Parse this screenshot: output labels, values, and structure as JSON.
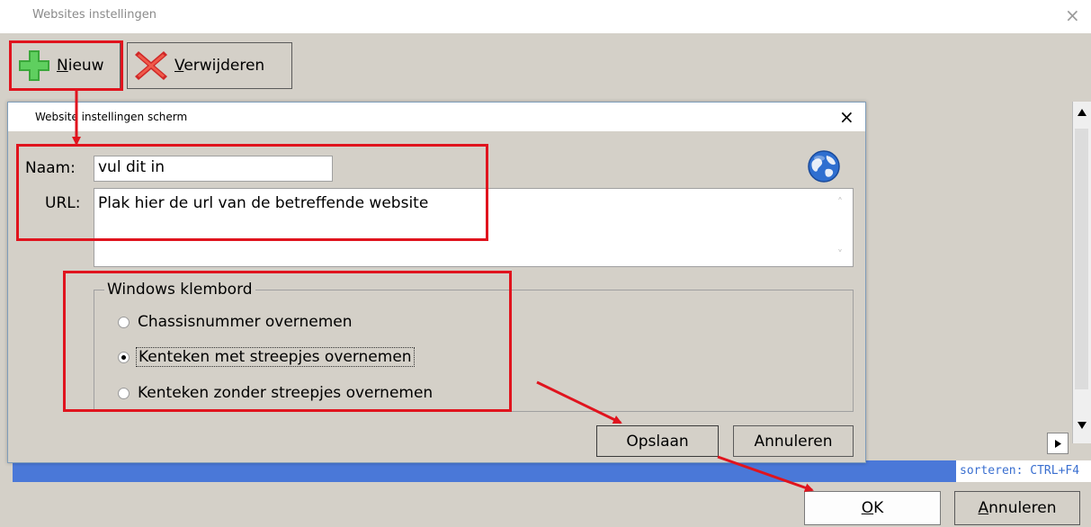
{
  "outer_window": {
    "title": "Websites instellingen",
    "close_glyph": "×"
  },
  "toolbar": {
    "new_label_ul": "N",
    "new_label_rest": "ieuw",
    "delete_label_ul": "V",
    "delete_label_rest": "erwijderen",
    "new_icon": "green-plus-icon",
    "delete_icon": "red-x-icon"
  },
  "dialog": {
    "title": "Website instellingen scherm",
    "close_glyph": "×",
    "name_label": "Naam:",
    "name_value": "vul dit in",
    "url_label": "URL:",
    "url_value": "Plak hier de url van de betreffende website",
    "globe_icon": "globe-icon",
    "group_title": "Windows klembord",
    "options": [
      {
        "label": "Chassisnummer overnemen",
        "selected": false
      },
      {
        "label": "Kenteken met streepjes overnemen",
        "selected": true
      },
      {
        "label": "Kenteken zonder streepjes overnemen",
        "selected": false
      }
    ],
    "save_label": "Opslaan",
    "cancel_label": "Annuleren"
  },
  "status": {
    "hint": "sorteren: CTRL+F4"
  },
  "footer": {
    "ok_label_ul": "O",
    "ok_label_rest": "K",
    "cancel_label_ul": "A",
    "cancel_label_rest": "nnuleren"
  },
  "annotation_color": "#e0141e"
}
